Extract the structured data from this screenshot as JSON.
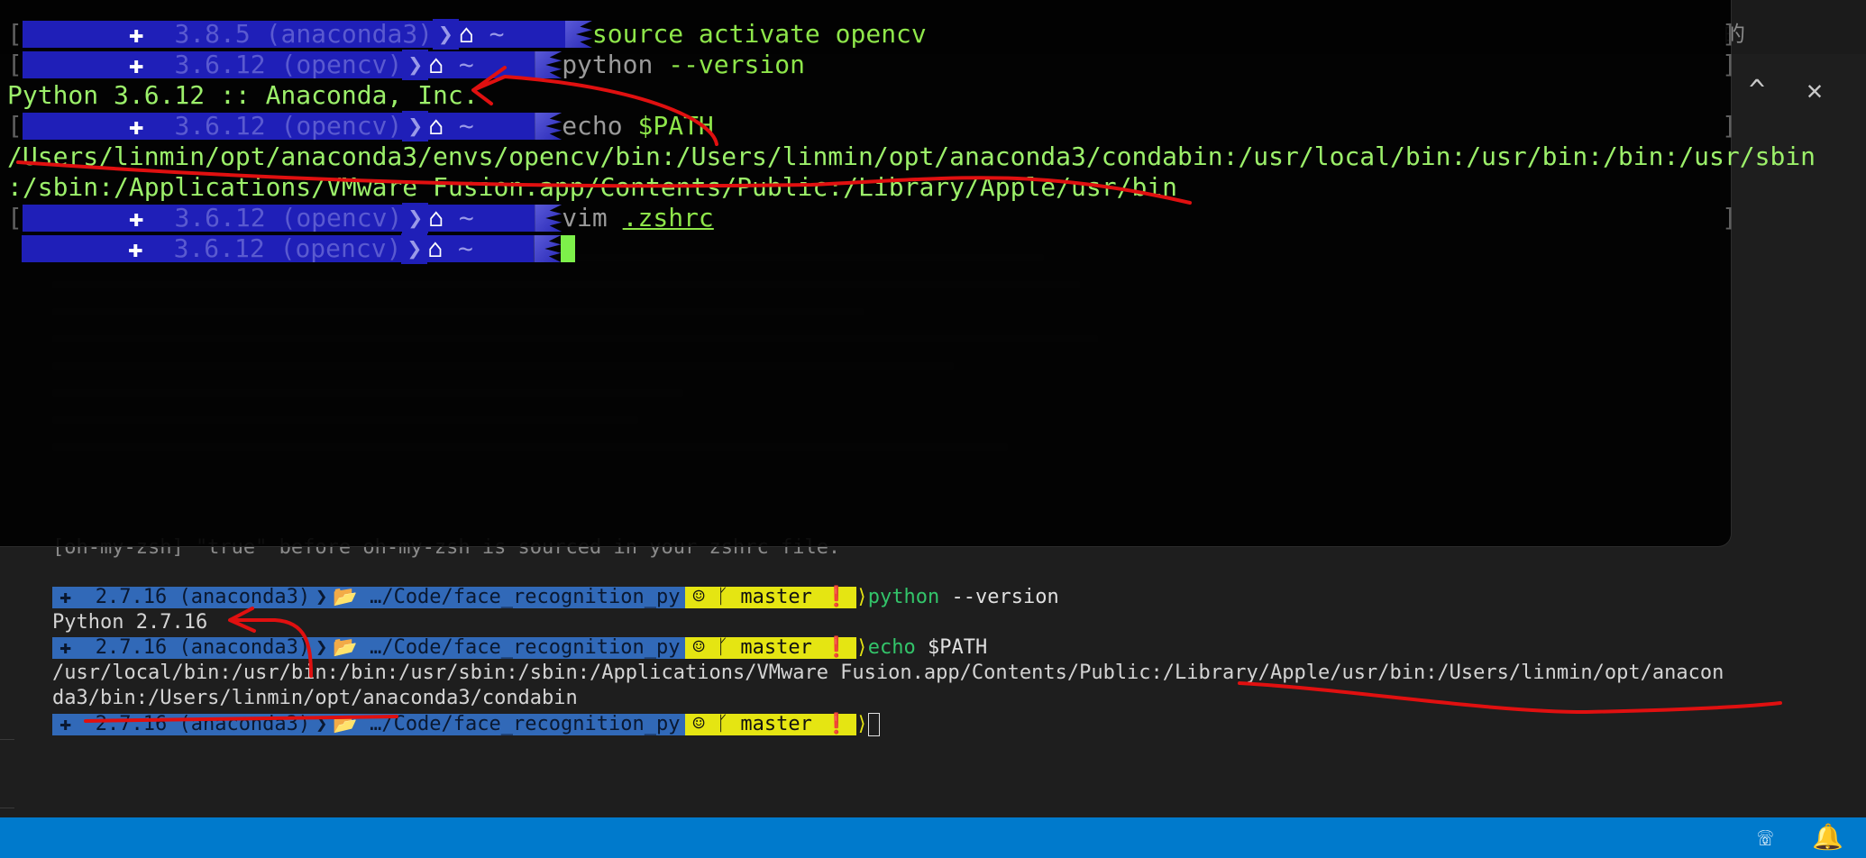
{
  "vscode": {
    "top_right_text": "的",
    "panel_controls": {
      "maximize": "^",
      "close": "✕"
    },
    "status_icons": [
      "feedback-icon",
      "bell-icon"
    ]
  },
  "overlay_terminal": {
    "prompt_icons": {
      "python": "✚",
      "home": "⌂",
      "tilde": "~",
      "chevron": "❯"
    },
    "lines": [
      {
        "version": "3.8.5 (anaconda3)",
        "cmd_green": "source activate opencv",
        "cmd_gray": ""
      },
      {
        "version": "3.6.12 (opencv)",
        "cmd_gray": "python",
        "cmd_green": " --version"
      },
      {
        "version": "3.6.12 (opencv)",
        "cmd_gray": "echo",
        "cmd_green": " $PATH"
      },
      {
        "version": "3.6.12 (opencv)",
        "cmd_gray": "vim",
        "cmd_green": ".zshrc"
      },
      {
        "version": "3.6.12 (opencv)"
      }
    ],
    "python_version_output": "Python 3.6.12 :: Anaconda, Inc.",
    "path_output_1": "/Users/linmin/opt/anaconda3/envs/opencv/bin:/Users/linmin/opt/anaconda3/condabin:/usr/local/bin:/usr/bin:/bin:/usr/sbin",
    "path_output_2": ":/sbin:/Applications/VMware Fusion.app/Contents/Public:/Library/Apple/usr/bin"
  },
  "vscode_terminal": {
    "partial_line": "[oh-my-zsh] \"true\" before oh-my-zsh is sourced in your zshrc file.",
    "prompt": {
      "version": "2.7.16 (anaconda3)",
      "folder": "…/Code/face_recognition_py",
      "branch": "master",
      "icons": {
        "python": "✚",
        "folder": "📂",
        "github": "☺",
        "branch": "ᚴ",
        "alert": "❗"
      }
    },
    "lines": [
      {
        "cmd_green": "python",
        "cmd_white": " --version"
      },
      {
        "cmd_green": "echo",
        "cmd_white": " $PATH"
      },
      {}
    ],
    "python_version_output": "Python 2.7.16",
    "path_output_1": "/usr/local/bin:/usr/bin:/bin:/usr/sbin:/sbin:/Applications/VMware Fusion.app/Contents/Public:/Library/Apple/usr/bin:/Users/linmin/opt/anacon",
    "path_output_2": "da3/bin:/Users/linmin/opt/anaconda3/condabin"
  }
}
